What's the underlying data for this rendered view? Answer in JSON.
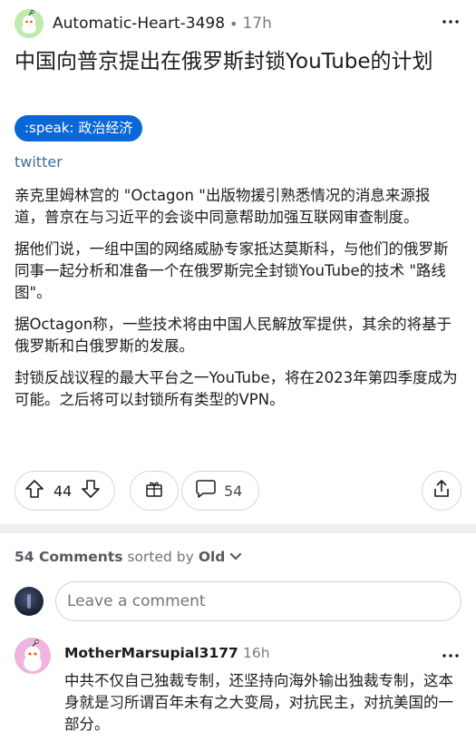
{
  "post": {
    "username": "Automatic-Heart-3498",
    "separator": "•",
    "time": "17h",
    "title": "中国向普京提出在俄罗斯封锁YouTube的计划",
    "flair": ":speak: 政治经济",
    "link_text": "twitter",
    "paragraphs": [
      "亲克里姆林宫的 \"Octagon \"出版物援引熟悉情况的消息来源报道，普京在与习近平的会谈中同意帮助加强互联网审查制度。",
      "据他们说，一组中国的网络威胁专家抵达莫斯科，与他们的俄罗斯同事一起分析和准备一个在俄罗斯完全封锁YouTube的技术 \"路线图\"。",
      "据Octagon称，一些技术将由中国人民解放军提供，其余的将基于俄罗斯和白俄罗斯的发展。",
      "封锁反战议程的最大平台之一YouTube，将在2023年第四季度成为可能。之后将可以封锁所有类型的VPN。"
    ],
    "vote_count": "44",
    "comment_count": "54",
    "icons": {
      "avatar": "snoo-avatar-icon",
      "more": "more-horizontal-icon",
      "upvote": "upvote-arrow-icon",
      "downvote": "downvote-arrow-icon",
      "award": "award-icon",
      "comment": "comment-bubble-icon",
      "share": "share-icon"
    }
  },
  "comments_header": {
    "count_label": "54 Comments",
    "sorted_by_label": "sorted by",
    "sort_value": "Old"
  },
  "composer": {
    "placeholder": "Leave a comment"
  },
  "comments": [
    {
      "username": "MotherMarsupial3177",
      "time": "16h",
      "text": "中共不仅自己独裁专制，还坚持向海外输出独裁专制，这本身就是习所谓百年未有之大变局，对抗民主，对抗美国的一部分。"
    }
  ],
  "colors": {
    "flair_bg": "#0a67d8",
    "link": "#3d6e9e",
    "post_avatar_bg": "#bfe9ad",
    "comment_avatar_bg": "#f0b4df",
    "separator": "#edeff1"
  }
}
